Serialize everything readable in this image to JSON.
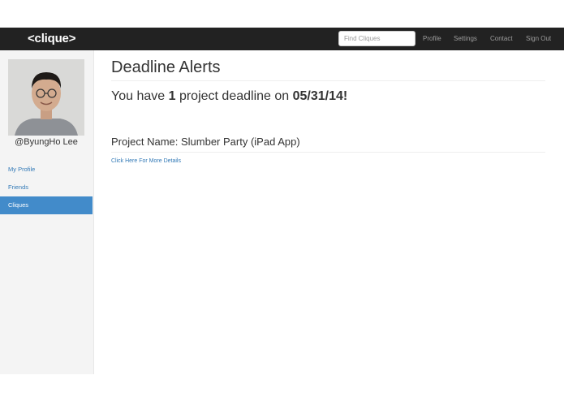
{
  "navbar": {
    "brand": "<clique>",
    "search_placeholder": "Find Cliques",
    "links": [
      "Profile",
      "Settings",
      "Contact",
      "Sign Out"
    ]
  },
  "sidebar": {
    "username": "@ByungHo Lee",
    "items": [
      {
        "label": "My Profile",
        "active": false
      },
      {
        "label": "Friends",
        "active": false
      },
      {
        "label": "Cliques",
        "active": true
      }
    ]
  },
  "main": {
    "title": "Deadline Alerts",
    "alert": {
      "prefix": "You have ",
      "count": "1",
      "middle": " project deadline on ",
      "date": "05/31/14!"
    },
    "project_name": "Project Name: Slumber Party (iPad App)",
    "details_link": "Click Here For More Details"
  },
  "colors": {
    "navbar_bg": "#222222",
    "active_item": "#428bca",
    "link": "#337ab7"
  }
}
